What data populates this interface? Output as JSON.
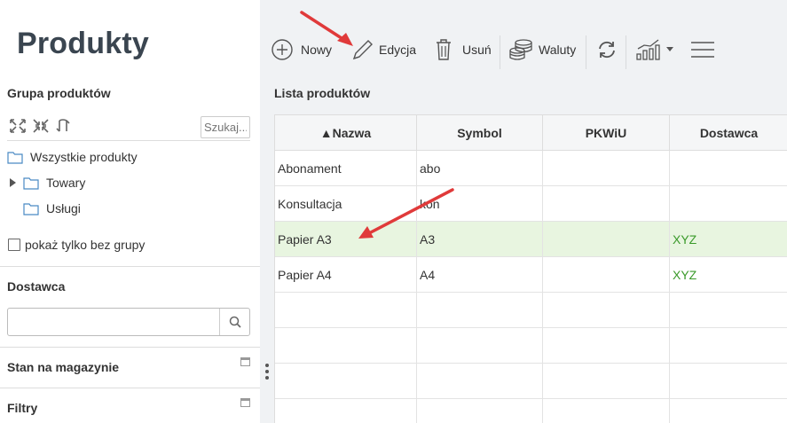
{
  "page": {
    "title": "Produkty"
  },
  "groups": {
    "title": "Grupa produktów",
    "search_placeholder": "Szukaj...",
    "tools": [
      "expand-icon",
      "collapse-icon",
      "refresh-icon"
    ],
    "tree": [
      {
        "label": "Wszystkie produkty",
        "icon": "folder-icon"
      },
      {
        "label": "Towary",
        "icon": "folder-icon",
        "expandable": true
      },
      {
        "label": "Usługi",
        "icon": "folder-icon"
      }
    ],
    "only_without_group_label": "pokaż tylko bez grupy"
  },
  "supplier_filter": {
    "title": "Dostawca",
    "value": ""
  },
  "stock_panel": {
    "title": "Stan na magazynie"
  },
  "filters_panel": {
    "title": "Filtry"
  },
  "toolbar": {
    "new_label": "Nowy",
    "edit_label": "Edycja",
    "delete_label": "Usuń",
    "currencies_label": "Waluty"
  },
  "list": {
    "title": "Lista produktów",
    "columns": [
      "▲Nazwa",
      "Symbol",
      "PKWiU",
      "Dostawca"
    ],
    "rows": [
      {
        "nazwa": "Abonament",
        "symbol": "abo",
        "pkwiu": "",
        "dostawca": ""
      },
      {
        "nazwa": "Konsultacja",
        "symbol": "kon",
        "pkwiu": "",
        "dostawca": ""
      },
      {
        "nazwa": "Papier A3",
        "symbol": "A3",
        "pkwiu": "",
        "dostawca": "XYZ",
        "selected": true
      },
      {
        "nazwa": "Papier A4",
        "symbol": "A4",
        "pkwiu": "",
        "dostawca": "XYZ"
      }
    ]
  },
  "colors": {
    "accent_green": "#3a9a2a",
    "selected_row": "#e8f5e0",
    "annotation_arrow": "#e03a3a"
  }
}
